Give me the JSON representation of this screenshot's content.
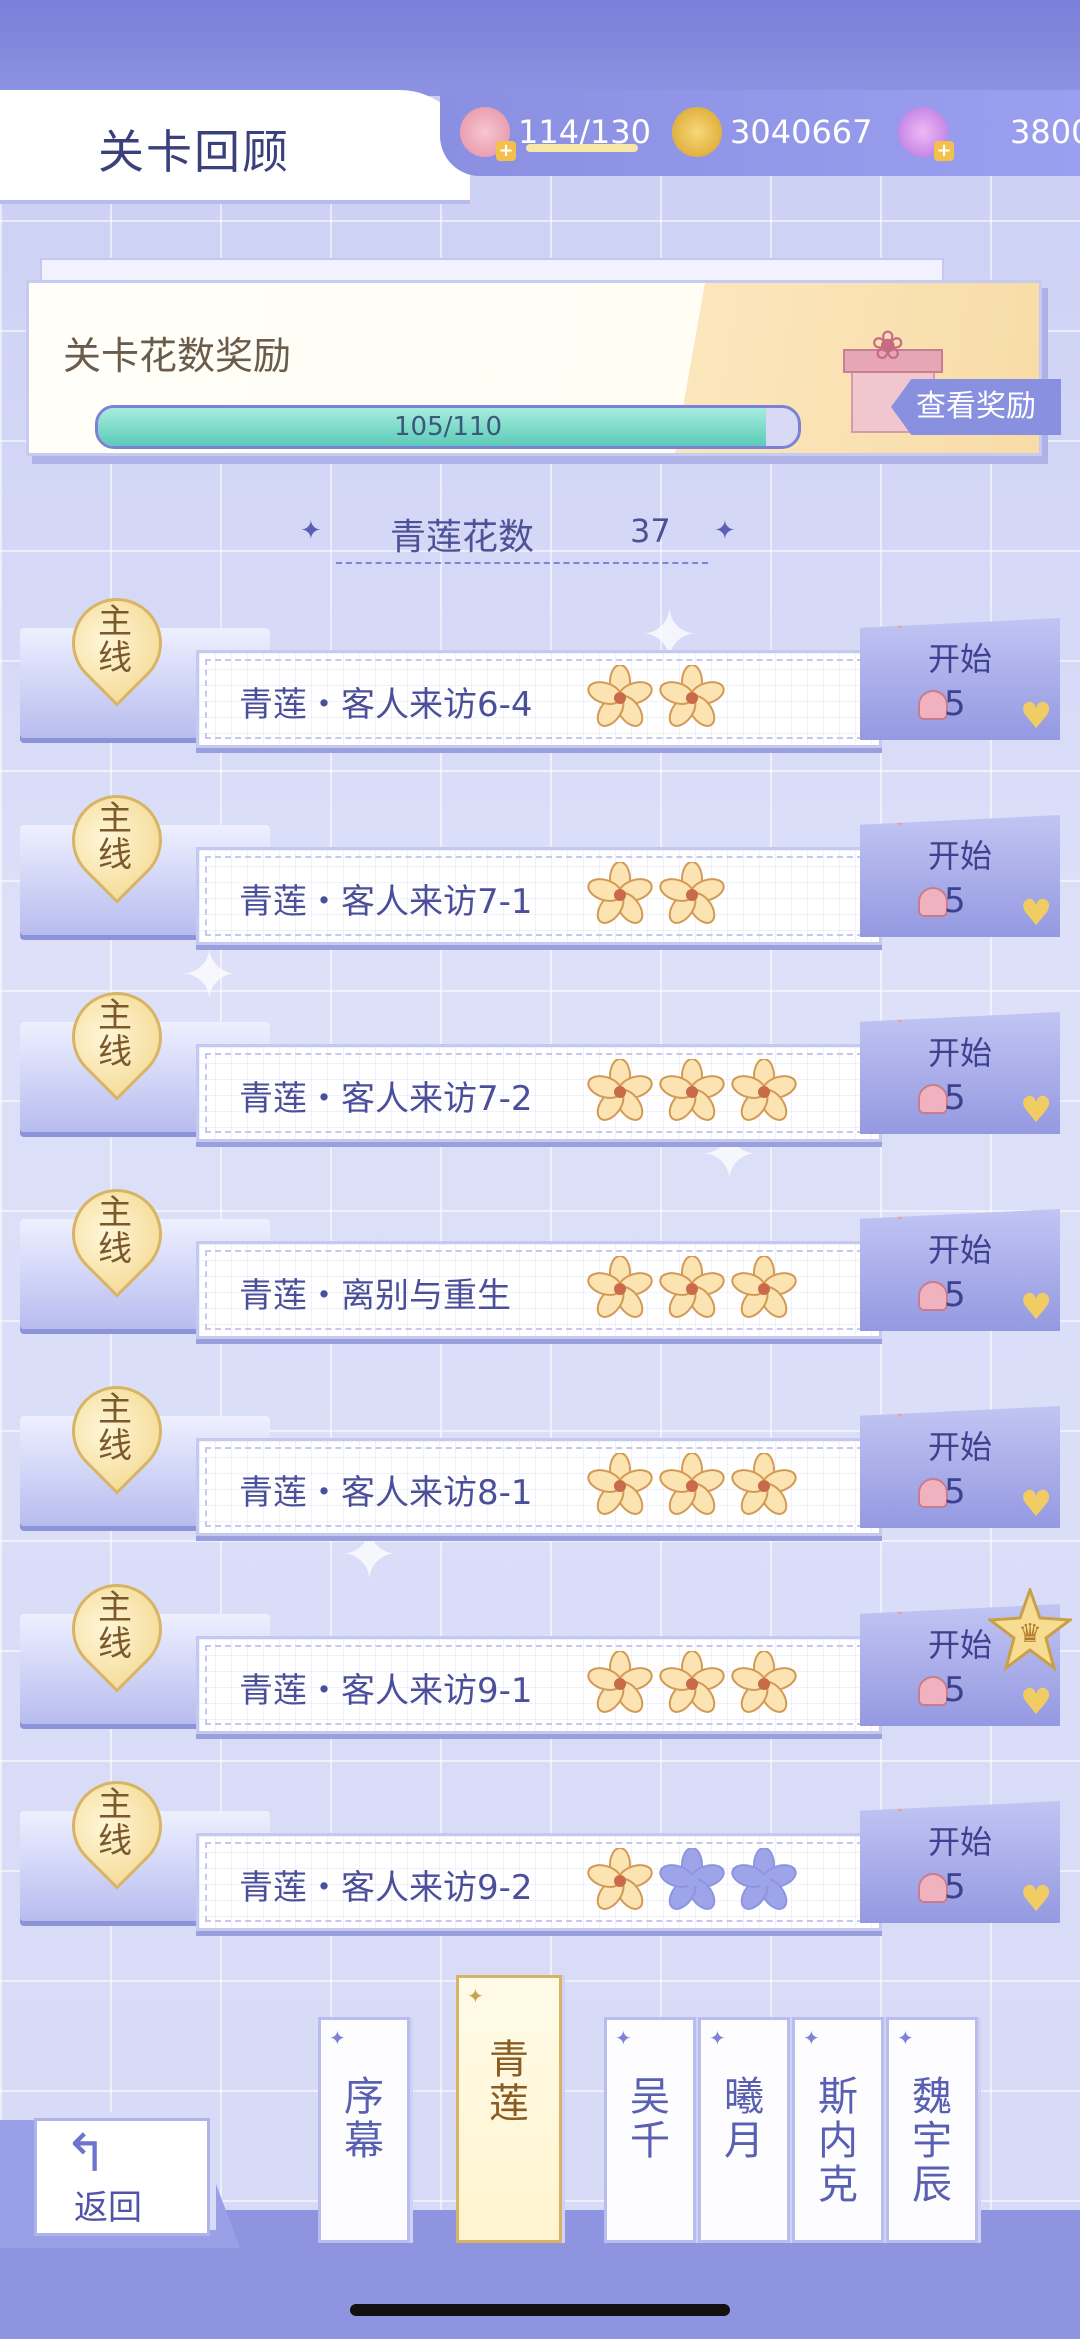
{
  "header": {
    "title": "关卡回顾",
    "stamina": "114/130",
    "coins": "3040667",
    "gems": "3800"
  },
  "reward": {
    "title": "关卡花数奖励",
    "progress_text": "105/110",
    "progress_value": 0.9545,
    "view_button": "查看奖励"
  },
  "flower_count": {
    "label": "青莲花数",
    "value": "37"
  },
  "levels": [
    {
      "tag": "主线",
      "name": "青莲・客人来访6-4",
      "flowers_earned": 2,
      "flowers_total": 2,
      "start": "开始",
      "cost": "5"
    },
    {
      "tag": "主线",
      "name": "青莲・客人来访7-1",
      "flowers_earned": 2,
      "flowers_total": 2,
      "start": "开始",
      "cost": "5"
    },
    {
      "tag": "主线",
      "name": "青莲・客人来访7-2",
      "flowers_earned": 3,
      "flowers_total": 3,
      "start": "开始",
      "cost": "5"
    },
    {
      "tag": "主线",
      "name": "青莲・离别与重生",
      "flowers_earned": 3,
      "flowers_total": 3,
      "start": "开始",
      "cost": "5"
    },
    {
      "tag": "主线",
      "name": "青莲・客人来访8-1",
      "flowers_earned": 3,
      "flowers_total": 3,
      "start": "开始",
      "cost": "5"
    },
    {
      "tag": "主线",
      "name": "青莲・客人来访9-1",
      "flowers_earned": 3,
      "flowers_total": 3,
      "start": "开始",
      "cost": "5"
    },
    {
      "tag": "主线",
      "name": "青莲・客人来访9-2",
      "flowers_earned": 1,
      "flowers_total": 3,
      "start": "开始",
      "cost": "5"
    }
  ],
  "tabs": [
    {
      "label": "序幕",
      "active": false
    },
    {
      "label": "青莲",
      "active": true
    },
    {
      "label": "吴千",
      "active": false
    },
    {
      "label": "曦月",
      "active": false
    },
    {
      "label": "斯内克",
      "active": false
    },
    {
      "label": "魏宇辰",
      "active": false
    }
  ],
  "back_button": "返回",
  "colors": {
    "accent": "#8a90e0",
    "gold": "#f3d78d",
    "text_primary": "#4b4f9a"
  }
}
